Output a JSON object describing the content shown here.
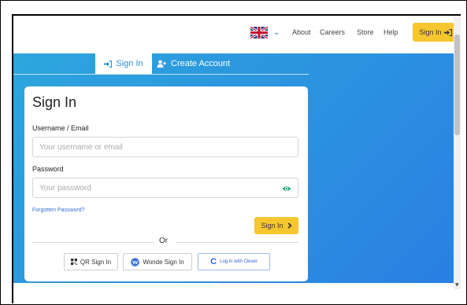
{
  "nav": {
    "language": "en-GB",
    "links": [
      "About",
      "Careers",
      "Store",
      "Help"
    ],
    "signin_label": "Sign In"
  },
  "tabs": {
    "signin": "Sign In",
    "create": "Create Account"
  },
  "form": {
    "title": "Sign In",
    "username_label": "Username / Email",
    "username_placeholder": "Your username or email",
    "password_label": "Password",
    "password_placeholder": "Your password",
    "forgot_label": "Forgotten Password?",
    "submit_label": "Sign In",
    "or_label": "Or",
    "qr_label": "QR Sign In",
    "wonde_label": "Wonde Sign In",
    "clever_label": "Log in with Clever"
  },
  "colors": {
    "accent_yellow": "#f6c62f",
    "panel_blue": "#2b8fe0",
    "link_blue": "#3b6fd6",
    "eye_green": "#1aa37a"
  },
  "icons": [
    "uk-flag-icon",
    "chevron-down-icon",
    "sign-in-icon",
    "add-user-icon",
    "eye-icon",
    "chevron-right-icon",
    "qr-code-icon",
    "wonde-icon",
    "clever-icon"
  ]
}
